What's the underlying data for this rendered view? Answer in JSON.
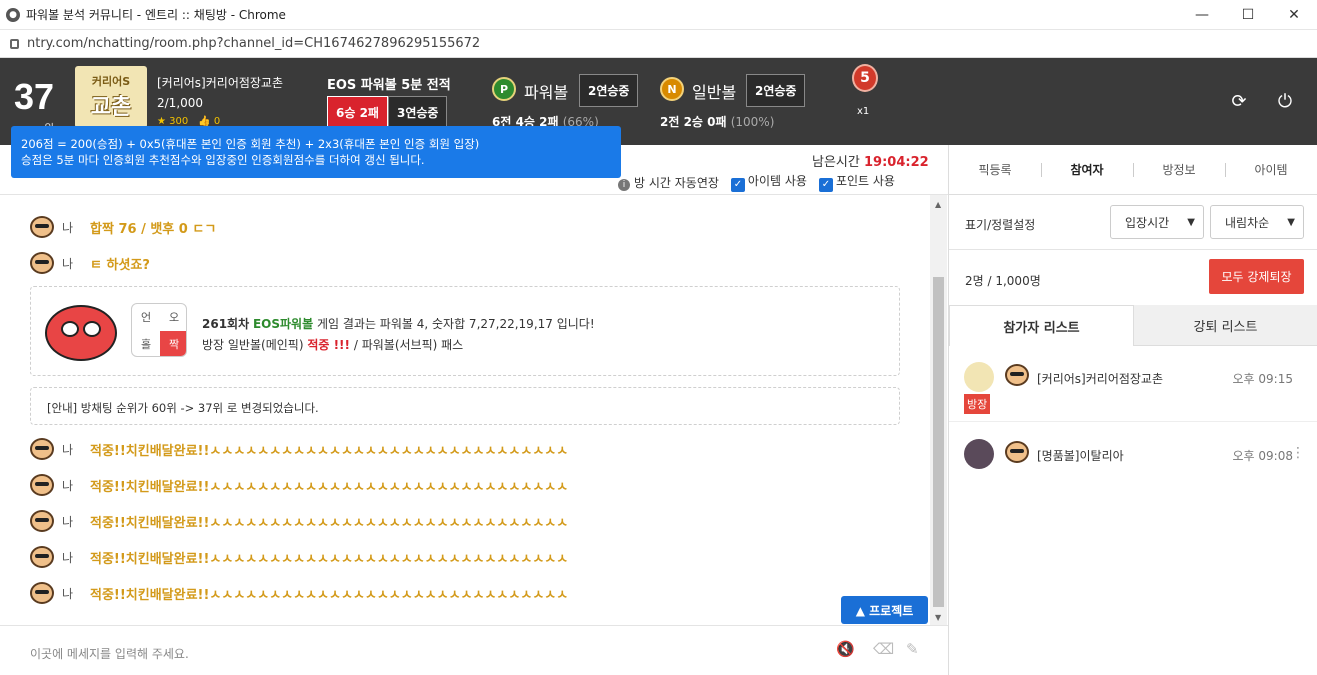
{
  "window": {
    "title": "파워볼 분석 커뮤니티 - 엔트리 :: 채팅방 - Chrome",
    "url": "ntry.com/nchatting/room.php?channel_id=CH1674627896295155672",
    "minimize": "—",
    "maximize": "☐",
    "close": "✕"
  },
  "header": {
    "rank": "37",
    "rank_sub": "위",
    "logo_line1": "커리어S",
    "logo_line2": "교촌",
    "room_name": "[커리어s]커리어점장교촌",
    "member_count": "2/1,000",
    "stars": "★ 300",
    "likes": "👍 0",
    "eos_title": "EOS 파워볼 5분 전적",
    "eos_record": "6승 2패",
    "eos_streak": "3연승중",
    "powerball_label": "파워볼",
    "powerball_icon": "P",
    "powerball_streak": "2연승중",
    "powerball_stat": "6전 4승 2패",
    "powerball_pct": "(66%)",
    "normal_label": "일반볼",
    "normal_icon": "N",
    "normal_streak": "2연승중",
    "normal_stat": "2전 2승 0패",
    "normal_pct": "(100%)",
    "medal_num": "5",
    "medal_mult": "x1",
    "refresh_icon": "⟳",
    "power_icon": "⏻"
  },
  "tooltip": {
    "line1": "206점 = 200(승점) + 0x5(휴대폰 본인 인증 회원 추천) + 2x3(휴대폰 본인 인증 회원 입장)",
    "line2": "승점은 5분 마다 인증회원 추천점수와 입장중인 인증회원점수를 더하여 갱신 됩니다."
  },
  "subbar": {
    "remain_label": "남은시간",
    "remain_time": "19:04:22",
    "auto_extend": "방 시간 자동연장",
    "item_use": "아이템 사용",
    "point_use": "포인트 사용"
  },
  "chat": {
    "messages_top": [
      {
        "nick": "나",
        "text": "합짝 76 / 뱃후 0 ㄷㄱ"
      },
      {
        "nick": "나",
        "text": "ㅌ 하셧죠?"
      }
    ],
    "result": {
      "g1": "언",
      "g2": "오",
      "g3": "홀",
      "g4": "짝",
      "round": "261회차",
      "game": "EOS파워볼",
      "result_text": "게임 결과는 파워볼 4, 숫자합 7,27,22,19,17 입니다!",
      "pick_prefix": "방장 일반볼(메인픽)",
      "hit": "적중 !!!",
      "pick_mid": "/ 파워볼(서브픽)",
      "pass": "패스"
    },
    "notice": "[안내] 방채팅 순위가 60위 -> 37위 로 변경되었습니다.",
    "messages_bottom": [
      {
        "nick": "나",
        "text": "적중!!치킨배달완료!!ㅅㅅㅅㅅㅅㅅㅅㅅㅅㅅㅅㅅㅅㅅㅅㅅㅅㅅㅅㅅㅅㅅㅅㅅㅅㅅㅅㅅㅅㅅ"
      },
      {
        "nick": "나",
        "text": "적중!!치킨배달완료!!ㅅㅅㅅㅅㅅㅅㅅㅅㅅㅅㅅㅅㅅㅅㅅㅅㅅㅅㅅㅅㅅㅅㅅㅅㅅㅅㅅㅅㅅㅅ"
      },
      {
        "nick": "나",
        "text": "적중!!치킨배달완료!!ㅅㅅㅅㅅㅅㅅㅅㅅㅅㅅㅅㅅㅅㅅㅅㅅㅅㅅㅅㅅㅅㅅㅅㅅㅅㅅㅅㅅㅅㅅ"
      },
      {
        "nick": "나",
        "text": "적중!!치킨배달완료!!ㅅㅅㅅㅅㅅㅅㅅㅅㅅㅅㅅㅅㅅㅅㅅㅅㅅㅅㅅㅅㅅㅅㅅㅅㅅㅅㅅㅅㅅㅅ"
      },
      {
        "nick": "나",
        "text": "적중!!치킨배달완료!!ㅅㅅㅅㅅㅅㅅㅅㅅㅅㅅㅅㅅㅅㅅㅅㅅㅅㅅㅅㅅㅅㅅㅅㅅㅅㅅㅅㅅㅅㅅ"
      }
    ],
    "project_button": "▲ 프로젝트",
    "input_placeholder": "이곳에 메세지를 입력해 주세요.",
    "mute_icon": "🔇",
    "eraser_icon": "⌫",
    "wand_icon": "✎"
  },
  "right": {
    "tabs": [
      "픽등록",
      "참여자",
      "방정보",
      "아이템"
    ],
    "sort_label": "표기/정렬설정",
    "sort_by": "입장시간",
    "sort_order": "내림차순",
    "count": "2명 / 1,000명",
    "kick_all": "모두 강제퇴장",
    "list_tabs": [
      "참가자 리스트",
      "강퇴 리스트"
    ],
    "users": [
      {
        "name": "[커리어s]커리어점장교촌",
        "time": "오후 09:15",
        "badge": "방장"
      },
      {
        "name": "[명품볼]이탈리아",
        "time": "오후 09:08",
        "dots": "⋮"
      }
    ]
  }
}
